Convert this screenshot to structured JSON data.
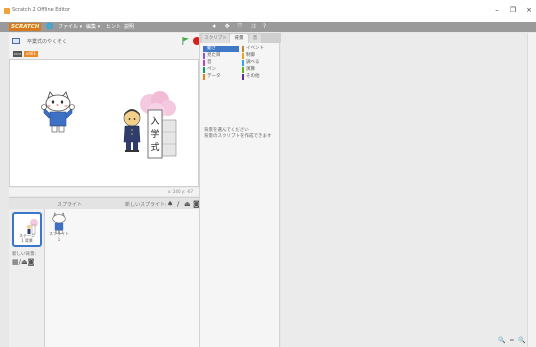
{
  "window": {
    "title": "Scratch 2 Offline Editor",
    "minimize": "–",
    "maximize": "❐",
    "close": "×"
  },
  "menu": {
    "logo": "SCRATCH",
    "items": [
      "ファイル ▾",
      "編集 ▾",
      "ヒント",
      "説明"
    ],
    "tool_icons": "⯌ ✥ ⤧ ⤨ ?"
  },
  "stage": {
    "project_title": "卒業式のやくそく",
    "version_badge": "v461",
    "coords": "x: 240 y: -67",
    "sign_text": "入学式"
  },
  "sprites": {
    "header_label": "スプライト",
    "new_sprite_label": "新しいスプライト:",
    "stage_caption": "ステージ\n1 背景",
    "new_backdrop_label": "新しい背景:",
    "sprite_names": [
      "スプライト1"
    ]
  },
  "palette": {
    "tabs": [
      "スクリプト",
      "背景",
      "音"
    ],
    "active_tab": 1,
    "categories_left": [
      "動き",
      "見た目",
      "音",
      "ペン",
      "データ"
    ],
    "categories_right": [
      "イベント",
      "制御",
      "調べる",
      "演算",
      "その他"
    ],
    "colors_left": [
      "#4a6cd4",
      "#8a55d7",
      "#bb42c3",
      "#0e9a6c",
      "#ee7d16"
    ],
    "colors_right": [
      "#c88330",
      "#e1a91a",
      "#2ca5e2",
      "#5cb712",
      "#632d99"
    ],
    "message_line1": "背景を選んでください",
    "message_line2": "背景のスクリプトを作成できます"
  },
  "zoom_controls": "🔍 = 🔍",
  "colors": {
    "accent": "#3f78c5",
    "logo_orange": "#d87a1f",
    "stop_red": "#d91e1e",
    "flag_green": "#2d8a34"
  }
}
